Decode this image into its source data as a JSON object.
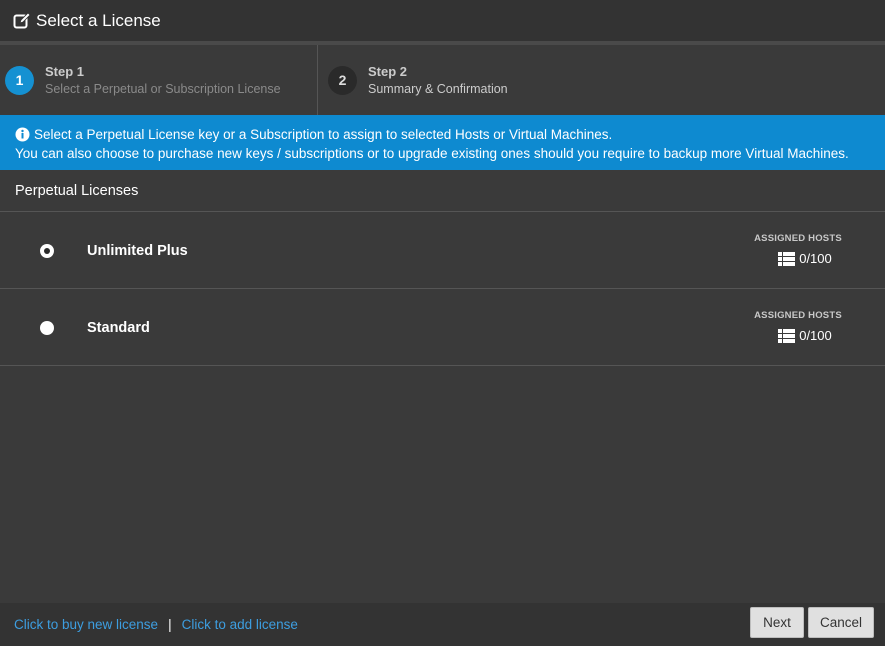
{
  "window": {
    "title": "Select a License",
    "title_icon": "edit-icon"
  },
  "steps": [
    {
      "number": "1",
      "title": "Step 1",
      "subtitle": "Select a Perpetual or Subscription License",
      "active": true
    },
    {
      "number": "2",
      "title": "Step 2",
      "subtitle": "Summary & Confirmation",
      "active": false
    }
  ],
  "info": {
    "line1": "Select a Perpetual License key or a Subscription to assign to selected Hosts or Virtual Machines.",
    "line2": "You can also choose to purchase new keys / subscriptions or to upgrade existing ones should you require to backup more Virtual Machines."
  },
  "section": {
    "title": "Perpetual Licenses"
  },
  "licenses": [
    {
      "name": "Unlimited Plus",
      "selected": true,
      "assigned_label": "ASSIGNED HOSTS",
      "assigned": "0/100"
    },
    {
      "name": "Standard",
      "selected": false,
      "assigned_label": "ASSIGNED HOSTS",
      "assigned": "0/100"
    }
  ],
  "footer": {
    "buy_link": "Click to buy new license",
    "separator": "|",
    "add_link": "Click to add license",
    "next_label": "Next",
    "cancel_label": "Cancel"
  },
  "colors": {
    "accent": "#1591d2",
    "info_bg": "#0e8ad0",
    "link": "#3d9ee0",
    "background": "#3a3a3a"
  }
}
